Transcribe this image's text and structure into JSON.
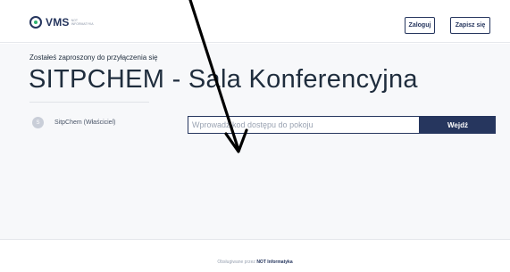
{
  "header": {
    "logo_text": "VMS",
    "logo_sub": "NOT INFORMATYKA",
    "login_label": "Zaloguj",
    "signup_label": "Zapisz się"
  },
  "main": {
    "invited_text": "Zostałeś zaproszony do przyłączenia się",
    "room_title": "SITPCHEM - Sala Konferencyjna",
    "owner": {
      "avatar_initial": "S",
      "name": "SitpChem (Właściciel)"
    },
    "access_code": {
      "placeholder": "Wprowadź kod dostępu do pokoju",
      "value": ""
    },
    "enter_label": "Wejdź"
  },
  "footer": {
    "prefix": "Obsługiwane przez",
    "brand": "NOT Informatyka"
  },
  "colors": {
    "brand": "#26365e",
    "accent": "#2fb36f",
    "hero_bg": "#f7f8fa"
  },
  "icons": {
    "logo": "vms-logo-icon",
    "annotation": "arrow-pointer-icon"
  }
}
